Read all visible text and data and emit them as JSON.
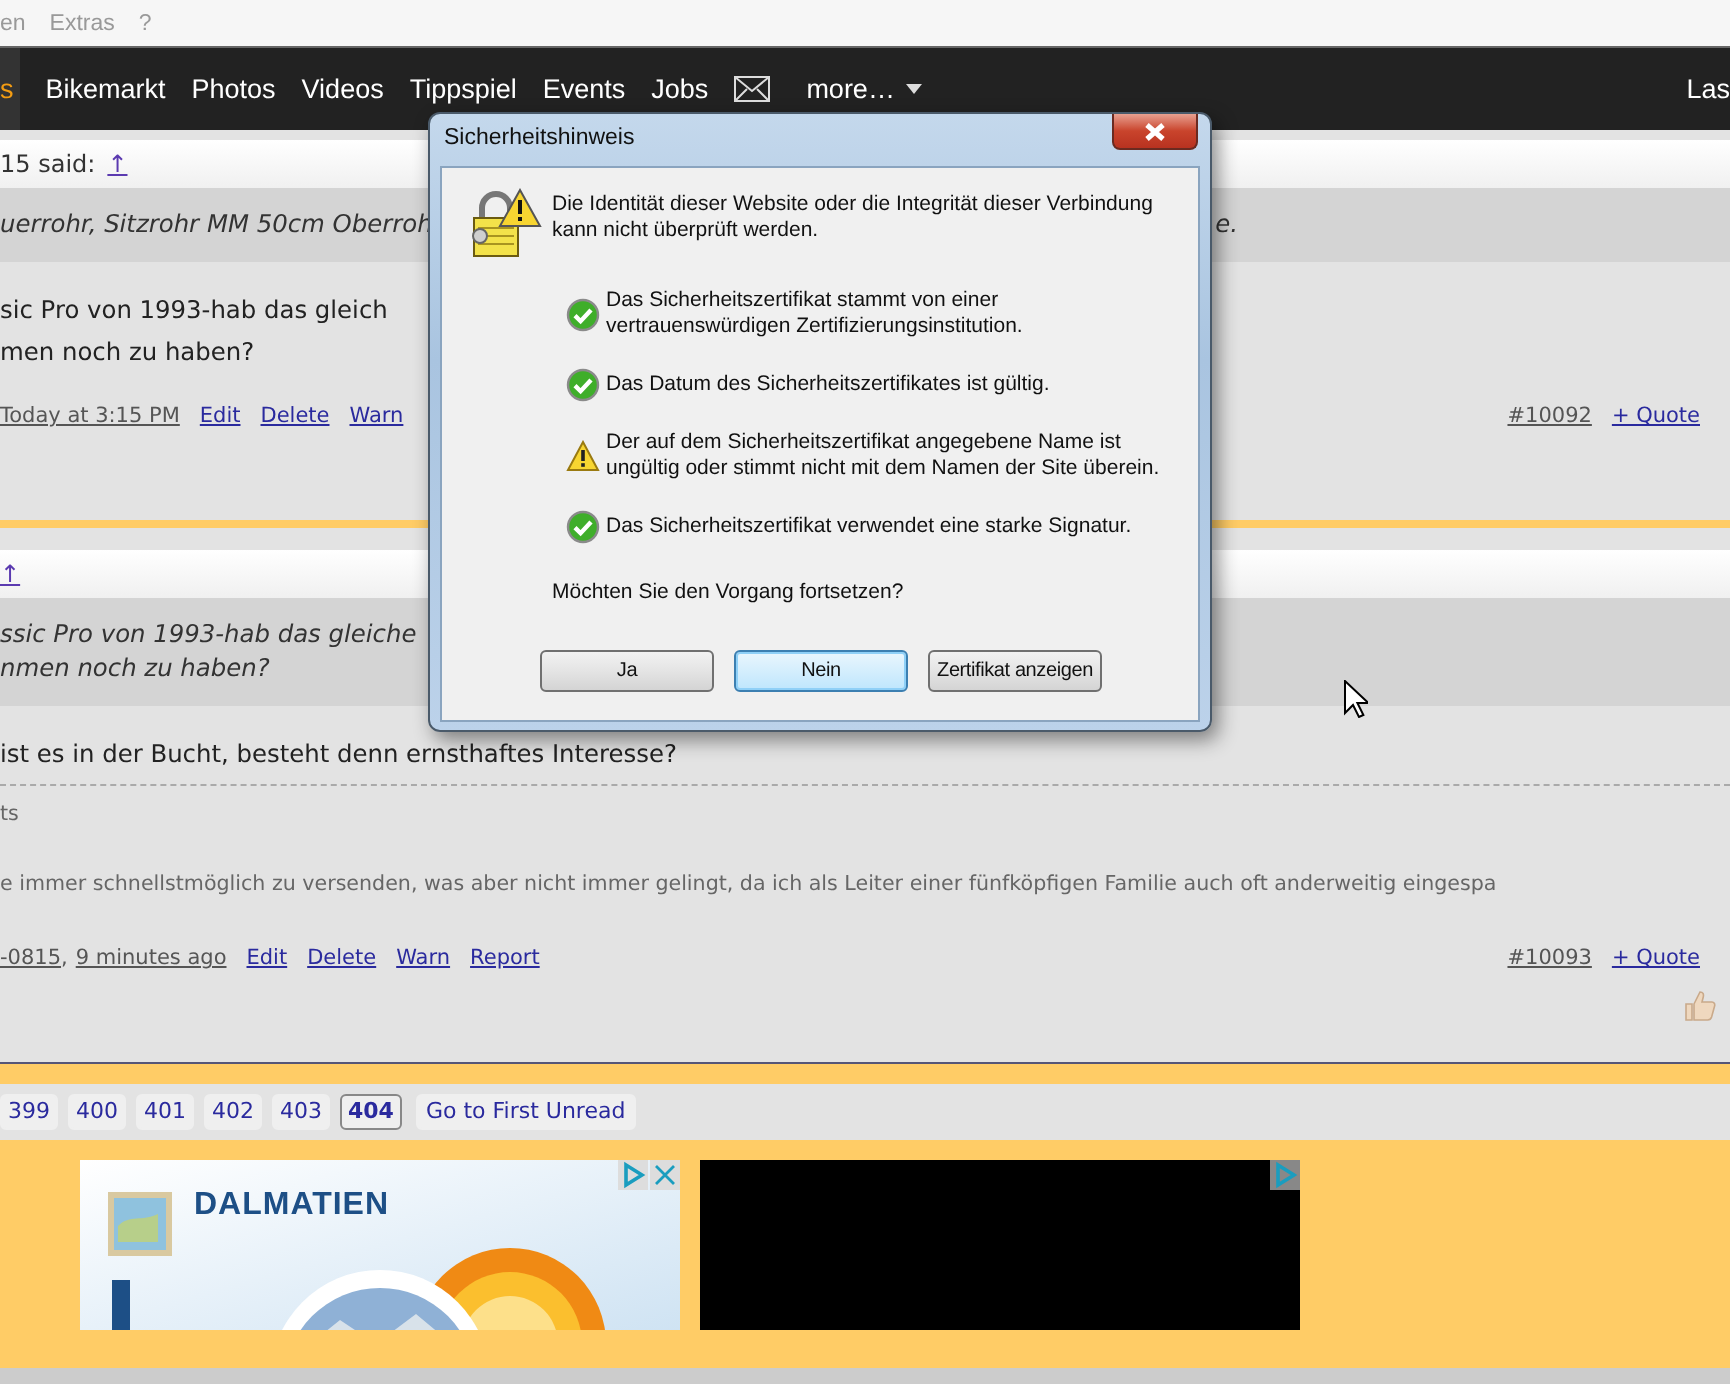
{
  "menu_bar": {
    "items": [
      "en",
      "Extras",
      "?"
    ]
  },
  "nav": {
    "items": [
      {
        "kind": "link",
        "label": "s",
        "selected": true
      },
      {
        "kind": "link",
        "label": "Bikemarkt",
        "selected": false
      },
      {
        "kind": "link",
        "label": "Photos",
        "selected": false
      },
      {
        "kind": "link",
        "label": "Videos",
        "selected": false
      },
      {
        "kind": "link",
        "label": "Tippspiel",
        "selected": false
      },
      {
        "kind": "link",
        "label": "Events",
        "selected": false
      },
      {
        "kind": "link",
        "label": "Jobs",
        "selected": false
      },
      {
        "kind": "mail",
        "selected": false
      },
      {
        "kind": "menu",
        "label": "more…",
        "selected": false
      }
    ],
    "right_link": "Las"
  },
  "posts": [
    {
      "header": {
        "author": "15 said:",
        "link": "↑"
      },
      "quote": [
        {
          "text": "uerrohr, Sitzrohr MM 50cm Oberroh",
          "tail": "e."
        }
      ],
      "body": [
        "sic Pro von 1993-hab das gleich",
        "men noch zu haben?"
      ],
      "meta": {
        "time": "Today at 3:15 PM"
      },
      "actions": [
        "Edit",
        "Delete",
        "Warn"
      ],
      "number": "#10092",
      "quote_button": "+ Quote",
      "like_button": false
    },
    {
      "header": {
        "link": "↑"
      },
      "quote": [
        {
          "text": "ssic Pro von 1993-hab das gleiche"
        },
        {
          "text": "nmen noch zu haben?"
        }
      ],
      "body": [
        "ist es in der Bucht, besteht denn ernsthaftes Interesse?"
      ],
      "signature": [
        "ts",
        "e immer schnellstmöglich zu versenden, was aber nicht immer gelingt, da ich als Leiter einer fünfköpfigen Familie auch oft anderweitig eingespa"
      ],
      "meta": {
        "author": "-0815",
        "separator": ",",
        "time": "9 minutes ago"
      },
      "actions": [
        "Edit",
        "Delete",
        "Warn",
        "Report"
      ],
      "number": "#10093",
      "quote_button": "+ Quote",
      "like_button": true
    }
  ],
  "pagination": {
    "pages": [
      {
        "label": "399",
        "selected": false
      },
      {
        "label": "400",
        "selected": false
      },
      {
        "label": "401",
        "selected": false
      },
      {
        "label": "402",
        "selected": false
      },
      {
        "label": "403",
        "selected": false
      },
      {
        "label": "404",
        "selected": true
      }
    ],
    "first_unread": "Go to First Unread"
  },
  "ads": [
    {
      "kind": "picture",
      "headline": "DALMATIEN"
    },
    {
      "kind": "dark"
    }
  ],
  "dialog": {
    "title": "Sicherheitshinweis",
    "intro": [
      "Die Identität dieser Website oder die Integrität dieser Verbindung",
      "kann nicht überprüft werden."
    ],
    "items": [
      {
        "kind": "ok",
        "lines": [
          "Das Sicherheitszertifikat stammt von einer",
          "vertrauenswürdigen Zertifizierungsinstitution."
        ]
      },
      {
        "kind": "ok",
        "lines": [
          "Das Datum des Sicherheitszertifikates ist gültig."
        ]
      },
      {
        "kind": "warning",
        "lines": [
          "Der auf dem Sicherheitszertifikat angegebene Name ist",
          "ungültig oder stimmt nicht mit dem Namen der Site überein."
        ]
      },
      {
        "kind": "ok",
        "lines": [
          "Das Sicherheitszertifikat verwendet eine starke Signatur."
        ]
      }
    ],
    "question": "Möchten Sie den Vorgang fortsetzen?",
    "buttons": [
      {
        "label": "Ja",
        "selected": false
      },
      {
        "label": "Nein",
        "selected": true
      },
      {
        "label": "Zertifikat anzeigen",
        "selected": false
      }
    ]
  }
}
